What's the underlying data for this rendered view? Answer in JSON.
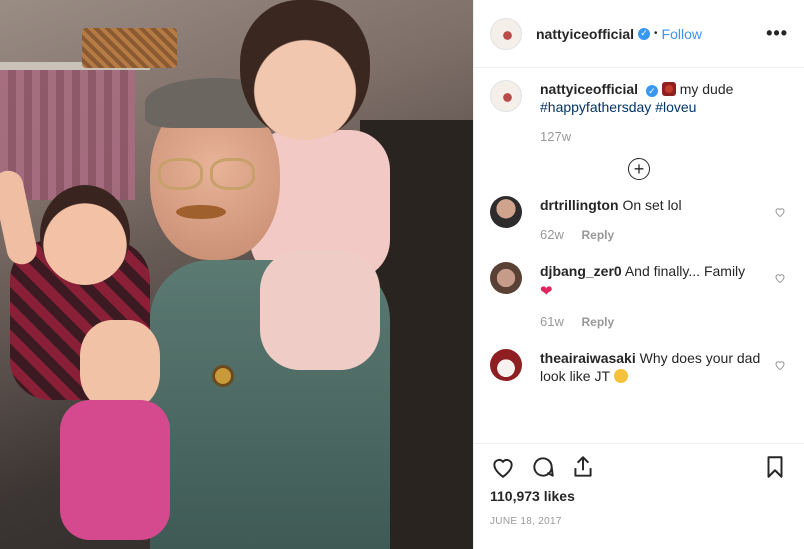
{
  "post": {
    "username": "nattyiceofficial",
    "follow_label": "Follow",
    "dot": "•",
    "more": "•••",
    "caption": {
      "username": "nattyiceofficial",
      "text": "my dude",
      "hashtags": "#happyfathersday #loveu",
      "time": "127w",
      "emoji": "flowers-emoji"
    },
    "load_more": "+",
    "likes": "110,973 likes",
    "date": "JUNE 18, 2017",
    "colors": {
      "accent": "#3897f0",
      "like_red": "#e0245e",
      "muted": "#999999"
    }
  },
  "comments": [
    {
      "username": "drtrillington",
      "text": "On set lol",
      "time": "62w",
      "reply": "Reply"
    },
    {
      "username": "djbang_zer0",
      "text": "And finally... Family",
      "time": "61w",
      "reply": "Reply",
      "emoji": "heart-emoji"
    },
    {
      "username": "theairaiwasaki",
      "text": "Why does your dad look like JT",
      "emoji": "laughing-emoji"
    }
  ],
  "icons": {
    "like": "heart-icon",
    "comment": "comment-icon",
    "share": "share-icon",
    "save": "bookmark-icon"
  }
}
